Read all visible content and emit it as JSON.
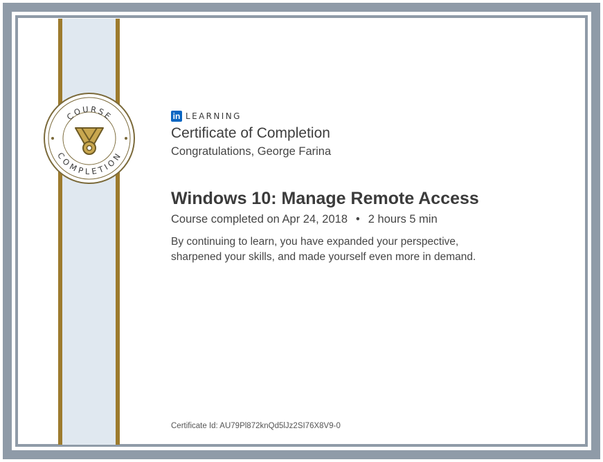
{
  "seal": {
    "top_text": "COURSE",
    "bottom_text": "COMPLETION"
  },
  "brand": {
    "logo_text": "in",
    "name": "LEARNING"
  },
  "certificate": {
    "title": "Certificate of Completion",
    "congratulations": "Congratulations, George Farina",
    "course_title": "Windows 10: Manage Remote Access",
    "completed_text": "Course completed on Apr 24, 2018",
    "separator": "•",
    "duration": "2 hours 5 min",
    "message": "By continuing to learn, you have expanded your perspective, sharpened your skills, and made yourself even more in demand.",
    "certificate_id": "Certificate Id: AU79Pl872knQd5lJz2SI76X8V9-0"
  },
  "colors": {
    "frame": "#8f9ba8",
    "ribbon": "#e0e8f0",
    "gold": "#9d7b2e",
    "linkedin_blue": "#0a66c2"
  },
  "icons": {
    "seal_center": "medal-icon",
    "brand_logo": "linkedin-logo-icon"
  }
}
